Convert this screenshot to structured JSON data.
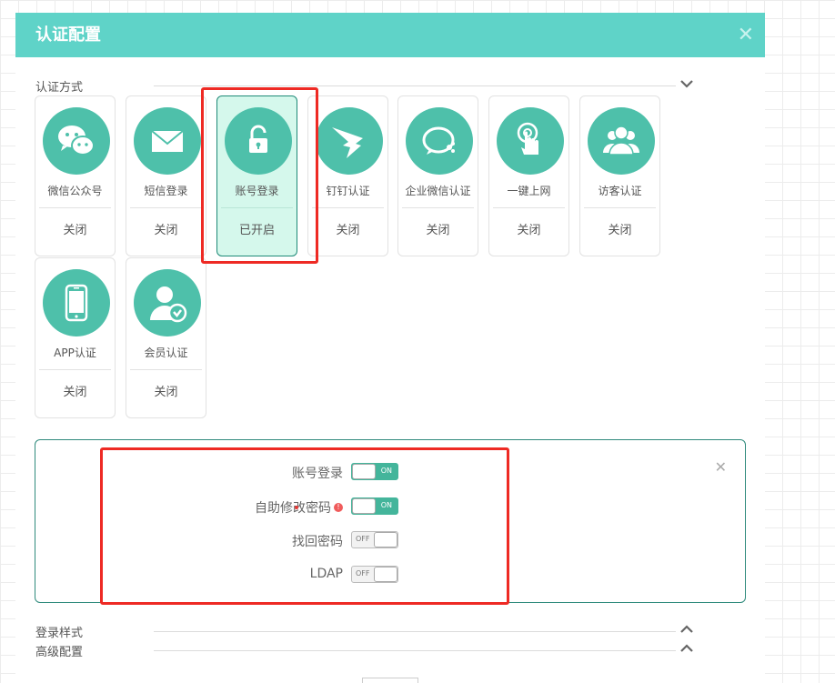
{
  "modal": {
    "title": "认证配置",
    "close_glyph": "✕"
  },
  "sections": {
    "auth_methods": "认证方式",
    "login_style": "登录样式",
    "advanced": "高级配置"
  },
  "auth_cards": [
    {
      "name": "微信公众号",
      "status": "关闭",
      "icon": "wechat-icon",
      "active": false
    },
    {
      "name": "短信登录",
      "status": "关闭",
      "icon": "envelope-icon",
      "active": false
    },
    {
      "name": "账号登录",
      "status": "已开启",
      "icon": "lock-icon",
      "active": true
    },
    {
      "name": "钉钉认证",
      "status": "关闭",
      "icon": "dingtalk-icon",
      "active": false
    },
    {
      "name": "企业微信认证",
      "status": "关闭",
      "icon": "wework-icon",
      "active": false
    },
    {
      "name": "一键上网",
      "status": "关闭",
      "icon": "tap-icon",
      "active": false
    },
    {
      "name": "访客认证",
      "status": "关闭",
      "icon": "visitors-icon",
      "active": false
    },
    {
      "name": "APP认证",
      "status": "关闭",
      "icon": "phone-icon",
      "active": false
    },
    {
      "name": "会员认证",
      "status": "关闭",
      "icon": "member-icon",
      "active": false
    }
  ],
  "settings": {
    "close_glyph": "✕",
    "info_glyph": "!",
    "rows": [
      {
        "label": "账号登录",
        "state": "ON",
        "on": true
      },
      {
        "label": "自助修改密码",
        "state": "ON",
        "on": true
      },
      {
        "label": "找回密码",
        "state": "OFF",
        "on": false
      },
      {
        "label": "LDAP",
        "state": "OFF",
        "on": false
      }
    ]
  },
  "colors": {
    "header": "#5fd3c8",
    "icon_bg": "#4ec0aa",
    "active_card": "#d5f8ec",
    "toggle_on": "#44b59b",
    "highlight": "#ee2a24"
  }
}
